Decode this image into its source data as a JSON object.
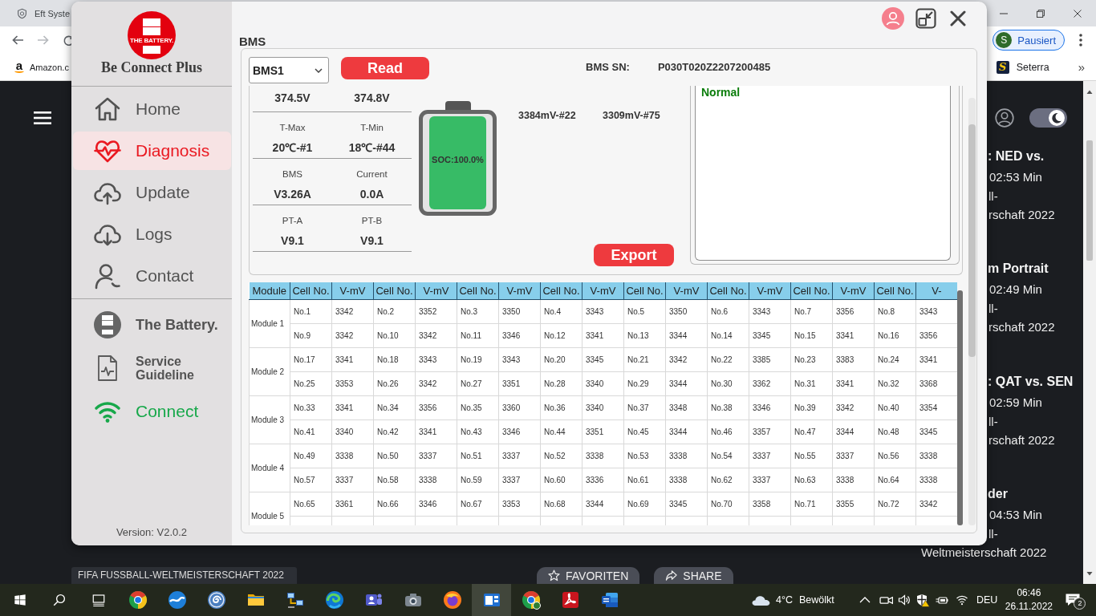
{
  "browser": {
    "tab": {
      "title": "Eft Syste"
    },
    "profile": {
      "initial": "S",
      "label": "Pausiert"
    },
    "bookmarks": [
      {
        "kind": "smile",
        "icon_text": "a",
        "label": "Amazon.c"
      },
      {
        "kind": "tile",
        "icon_text": "S",
        "label": "Seterra"
      }
    ],
    "bookmarks_overflow": "»"
  },
  "web_page": {
    "dark_mode": true,
    "articles": [
      {
        "title": ": NED vs.",
        "duration": "02:53 Min",
        "lines": [
          "ll-",
          "rschaft 2022"
        ]
      },
      {
        "title": "m Portrait",
        "duration": "02:49 Min",
        "lines": [
          "ll-",
          "rschaft 2022"
        ]
      },
      {
        "title": ": QAT vs. SEN",
        "duration": "02:59 Min",
        "lines": [
          "ll-",
          "rschaft 2022"
        ]
      },
      {
        "title": "der",
        "duration": "04:53 Min",
        "lines": [
          "ll-",
          "Weltmeisterschaft 2022"
        ]
      }
    ],
    "caption": "FIFA FUSSBALL-WELTMEISTERSCHAFT 2022",
    "actions": [
      {
        "kind": "star",
        "label": "FAVORITEN"
      },
      {
        "kind": "share",
        "label": "SHARE"
      }
    ]
  },
  "app": {
    "logo_text": "THE BATTERY.",
    "title": "Be Connect Plus",
    "nav": [
      {
        "kind": "home",
        "label": "Home",
        "selected": false
      },
      {
        "kind": "diagnosis",
        "label": "Diagnosis",
        "selected": true
      },
      {
        "kind": "update",
        "label": "Update",
        "selected": false
      },
      {
        "kind": "logs",
        "label": "Logs",
        "selected": false
      },
      {
        "kind": "contact",
        "label": "Contact",
        "selected": false
      }
    ],
    "links": [
      {
        "kind": "brand",
        "label": "The Battery.",
        "selected": false
      },
      {
        "kind": "guide",
        "label": "Service Guideline",
        "selected": false
      },
      {
        "kind": "connect",
        "label": "Connect",
        "selected": false,
        "connected": true
      }
    ],
    "version": "Version: V2.0.2",
    "section_title": "BMS",
    "bms_select": {
      "value": "BMS1"
    },
    "read_button": "Read",
    "serial": {
      "label": "BMS SN:",
      "value": "P030T020Z2207200485"
    },
    "readings": [
      [
        {
          "value": "374.5V"
        },
        {
          "value": "374.8V"
        }
      ],
      [
        {
          "label": "T-Max",
          "value": "20℃-#1"
        },
        {
          "label": "T-Min",
          "value": "18℃-#44"
        }
      ],
      [
        {
          "label": "BMS",
          "value": "V3.26A"
        },
        {
          "label": "Current",
          "value": "0.0A"
        }
      ],
      [
        {
          "label": "PT-A",
          "value": "V9.1"
        },
        {
          "label": "PT-B",
          "value": "V9.1"
        }
      ]
    ],
    "battery": {
      "text": "SOC:100.0%",
      "level": 1
    },
    "cell_extremes": [
      "3384mV-#22",
      "3309mV-#75"
    ],
    "export_button": "Export",
    "status_log": [
      "Normal"
    ],
    "cell_table": {
      "columns": [
        "Module",
        "Cell No.",
        "V-mV",
        "Cell No.",
        "V-mV",
        "Cell No.",
        "V-mV",
        "Cell No.",
        "V-mV",
        "Cell No.",
        "V-mV",
        "Cell No.",
        "V-mV",
        "Cell No.",
        "V-mV",
        "Cell No.",
        "V-"
      ],
      "modules": [
        {
          "name": "Module 1",
          "rows": [
            [
              "No.1",
              "3342",
              "No.2",
              "3352",
              "No.3",
              "3350",
              "No.4",
              "3343",
              "No.5",
              "3350",
              "No.6",
              "3343",
              "No.7",
              "3356",
              "No.8",
              "3343"
            ],
            [
              "No.9",
              "3342",
              "No.10",
              "3342",
              "No.11",
              "3346",
              "No.12",
              "3341",
              "No.13",
              "3344",
              "No.14",
              "3345",
              "No.15",
              "3341",
              "No.16",
              "3356"
            ]
          ]
        },
        {
          "name": "Module 2",
          "rows": [
            [
              "No.17",
              "3341",
              "No.18",
              "3343",
              "No.19",
              "3343",
              "No.20",
              "3345",
              "No.21",
              "3342",
              "No.22",
              "3385",
              "No.23",
              "3383",
              "No.24",
              "3341"
            ],
            [
              "No.25",
              "3353",
              "No.26",
              "3342",
              "No.27",
              "3351",
              "No.28",
              "3340",
              "No.29",
              "3344",
              "No.30",
              "3362",
              "No.31",
              "3341",
              "No.32",
              "3368"
            ]
          ]
        },
        {
          "name": "Module 3",
          "rows": [
            [
              "No.33",
              "3341",
              "No.34",
              "3356",
              "No.35",
              "3360",
              "No.36",
              "3340",
              "No.37",
              "3348",
              "No.38",
              "3346",
              "No.39",
              "3342",
              "No.40",
              "3354"
            ],
            [
              "No.41",
              "3340",
              "No.42",
              "3341",
              "No.43",
              "3346",
              "No.44",
              "3351",
              "No.45",
              "3344",
              "No.46",
              "3357",
              "No.47",
              "3344",
              "No.48",
              "3345"
            ]
          ]
        },
        {
          "name": "Module 4",
          "rows": [
            [
              "No.49",
              "3338",
              "No.50",
              "3337",
              "No.51",
              "3337",
              "No.52",
              "3338",
              "No.53",
              "3338",
              "No.54",
              "3337",
              "No.55",
              "3337",
              "No.56",
              "3338"
            ],
            [
              "No.57",
              "3337",
              "No.58",
              "3338",
              "No.59",
              "3337",
              "No.60",
              "3336",
              "No.61",
              "3338",
              "No.62",
              "3337",
              "No.63",
              "3338",
              "No.64",
              "3338"
            ]
          ]
        },
        {
          "name": "Module 5",
          "rows": [
            [
              "No.65",
              "3361",
              "No.66",
              "3346",
              "No.67",
              "3353",
              "No.68",
              "3344",
              "No.69",
              "3345",
              "No.70",
              "3358",
              "No.71",
              "3355",
              "No.72",
              "3342"
            ]
          ]
        }
      ]
    }
  },
  "taskbar": {
    "apps": [
      {
        "kind": "chrome",
        "selected": false
      },
      {
        "kind": "wave",
        "selected": false
      },
      {
        "kind": "swirl",
        "selected": false
      },
      {
        "kind": "folder",
        "selected": false
      },
      {
        "kind": "network",
        "selected": false
      },
      {
        "kind": "edge",
        "selected": false
      },
      {
        "kind": "teams",
        "selected": false
      },
      {
        "kind": "camera",
        "selected": false
      },
      {
        "kind": "firefox",
        "selected": false
      },
      {
        "kind": "app",
        "selected": true
      },
      {
        "kind": "chrome_badge",
        "selected": false
      },
      {
        "kind": "acrobat",
        "selected": false
      },
      {
        "kind": "word",
        "selected": false
      }
    ],
    "weather": {
      "temperature": "4°C",
      "condition": "Bewölkt"
    },
    "language": "DEU",
    "time": "06:46",
    "date": "26.11.2022",
    "notifications": "2"
  }
}
